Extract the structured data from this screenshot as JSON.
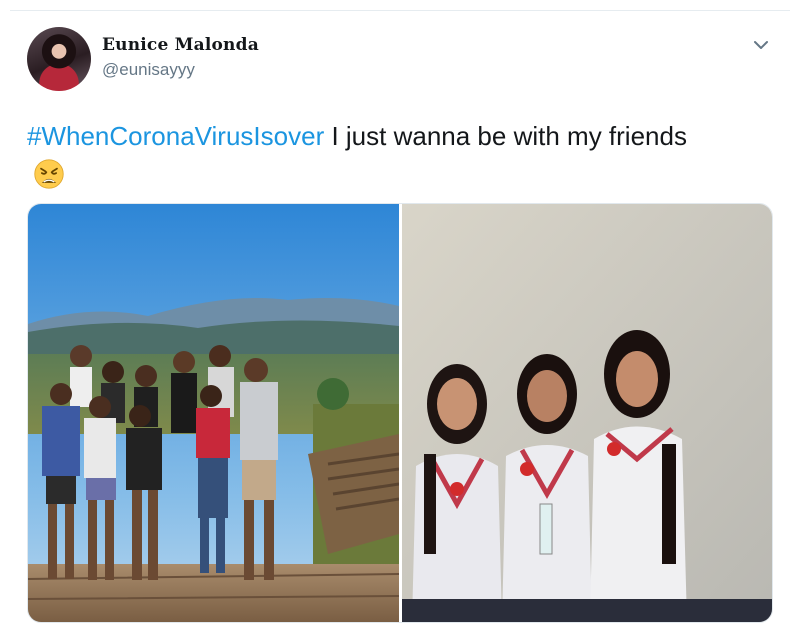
{
  "tweet": {
    "display_name": "Eunice Malonda",
    "handle": "@eunisayyy",
    "text_hashtag": "#WhenCoronaVirusIsover",
    "text_body": " I just wanna be with my friends",
    "emoji": "weary-face"
  },
  "icons": {
    "menu": "chevron-down-icon"
  },
  "colors": {
    "hashtag": "#1b95e0",
    "handle": "#657786"
  },
  "media": {
    "photo_count": 2
  }
}
